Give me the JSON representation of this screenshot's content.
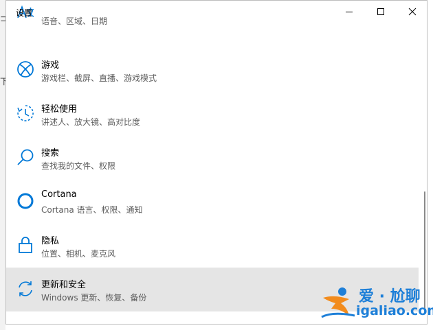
{
  "window": {
    "title": "设置"
  },
  "items": [
    {
      "title": "",
      "subtitle": "语音、区域、日期",
      "icon": "time-language-icon"
    },
    {
      "title": "游戏",
      "subtitle": "游戏栏、截屏、直播、游戏模式",
      "icon": "xbox-icon"
    },
    {
      "title": "轻松使用",
      "subtitle": "讲述人、放大镜、高对比度",
      "icon": "ease-of-access-icon"
    },
    {
      "title": "搜索",
      "subtitle": "查找我的文件、权限",
      "icon": "search-icon"
    },
    {
      "title": "Cortana",
      "subtitle": "Cortana 语言、权限、通知",
      "icon": "cortana-icon"
    },
    {
      "title": "隐私",
      "subtitle": "位置、相机、麦克风",
      "icon": "lock-icon"
    },
    {
      "title": "更新和安全",
      "subtitle": "Windows 更新、恢复、备份",
      "icon": "sync-icon"
    }
  ],
  "selected_index": 6,
  "colors": {
    "accent": "#0078d7",
    "selected_bg": "#e5e5e5",
    "watermark": "#1d7fd8",
    "watermark_orange": "#f28c1e"
  },
  "watermark": {
    "line1": "爱 · 尬聊",
    "line2": "igaliao.com"
  },
  "background": {
    "char1": "⊐",
    "char2": "下"
  }
}
